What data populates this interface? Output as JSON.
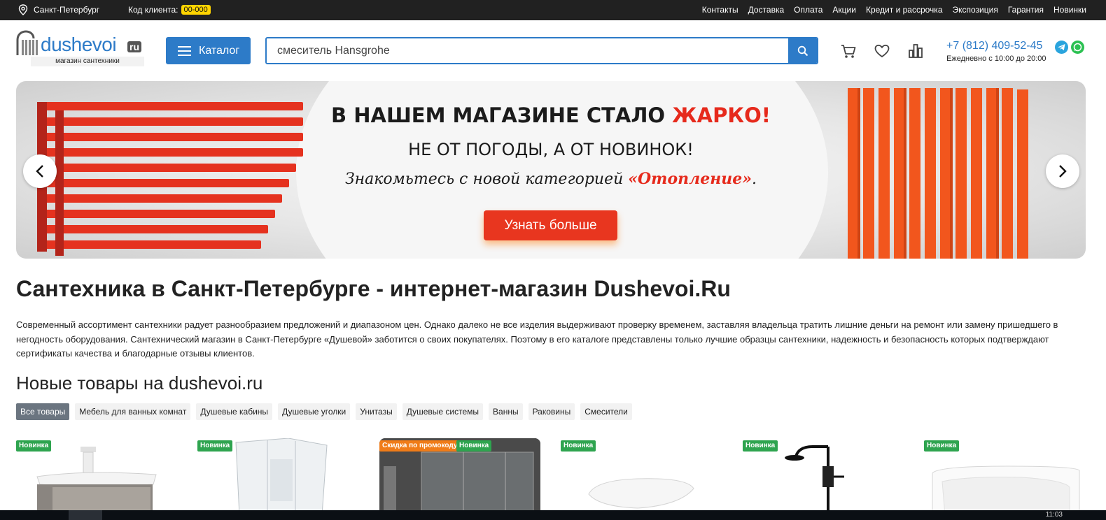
{
  "topbar": {
    "city": "Санкт-Петербург",
    "client_label": "Код клиента:",
    "client_code": "00-000",
    "links": [
      "Контакты",
      "Доставка",
      "Оплата",
      "Акции",
      "Кредит и рассрочка",
      "Экспозиция",
      "Гарантия",
      "Новинки"
    ]
  },
  "header": {
    "logo_word": "dushevoi",
    "logo_ru": "ru",
    "logo_sub": "магазин сантехники",
    "catalog_label": "Каталог",
    "search_value": "смеситель Hansgrohe",
    "phone": "+7 (812) 409-52-45",
    "hours": "Ежедневно с 10:00 до 20:00",
    "icons": [
      "cart-icon",
      "heart-icon",
      "compare-icon",
      "search-icon",
      "telegram-icon",
      "whatsapp-icon"
    ],
    "accent_color": "#2d7bc8"
  },
  "banner": {
    "title_prefix": "В НАШЕМ МАГАЗИНЕ СТАЛО ",
    "title_hot": "ЖАРКО!",
    "subtitle": "НЕ ОТ ПОГОДЫ, А ОТ НОВИНОК!",
    "text_prefix": "Знакомьтесь с новой категорией ",
    "text_category": "«Отопление»",
    "text_suffix": ".",
    "cta": "Узнать больше"
  },
  "main": {
    "title": "Сантехника в Санкт-Петербурге - интернет-магазин Dushevoi.Ru",
    "description": "Современный ассортимент сантехники радует разнообразием предложений и диапазоном цен. Однако далеко не все изделия выдерживают проверку временем, заставляя владельца тратить лишние деньги на ремонт или замену пришедшего в негодность оборудования. Сантехнический магазин в Санкт-Петербурге «Душевой» заботится о своих покупателях. Поэтому в его каталоге представлены только лучшие образцы сантехники, надежность и безопасность которых подтверждают сертификаты качества и благодарные отзывы клиентов.",
    "new_title": "Новые товары на dushevoi.ru",
    "tabs": [
      "Все товары",
      "Мебель для ванных комнат",
      "Душевые кабины",
      "Душевые уголки",
      "Унитазы",
      "Душевые системы",
      "Ванны",
      "Раковины",
      "Смесители"
    ],
    "badges": {
      "new": "Новинка",
      "promo": "Скидка по промокоду"
    }
  },
  "taskbar": {
    "clock": "11:03"
  }
}
